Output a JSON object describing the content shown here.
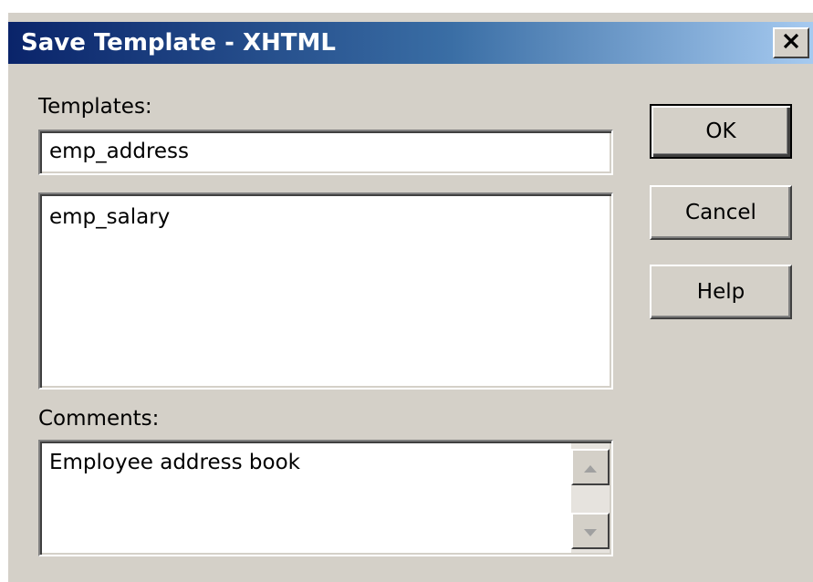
{
  "window": {
    "title": "Save Template - XHTML",
    "close_glyph": "✕"
  },
  "templates": {
    "label": "Templates:",
    "name_value": "emp_address",
    "list_items": [
      "emp_salary"
    ]
  },
  "comments": {
    "label": "Comments:",
    "value": "Employee address book"
  },
  "buttons": {
    "ok_label": "OK",
    "cancel_label": "Cancel",
    "help_label": "Help"
  },
  "colors": {
    "titlebar_start": "#0a246a",
    "titlebar_end": "#a6caf0",
    "dialog_face": "#d4d0c8"
  },
  "icons": {
    "close": "close-icon",
    "scroll_up": "scroll-up-arrow-icon",
    "scroll_down": "scroll-down-arrow-icon"
  }
}
